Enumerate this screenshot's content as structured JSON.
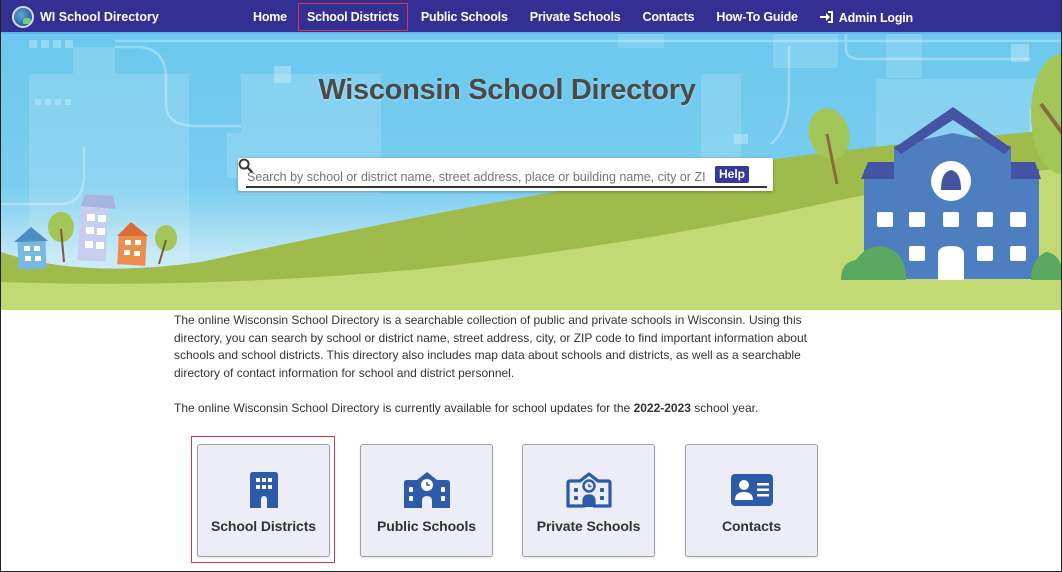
{
  "nav": {
    "brand": "WI School Directory",
    "brand_icon": "globe-logo-icon",
    "items": [
      {
        "label": "Home",
        "active": false
      },
      {
        "label": "School Districts",
        "active": true
      },
      {
        "label": "Public Schools",
        "active": false
      },
      {
        "label": "Private Schools",
        "active": false
      },
      {
        "label": "Contacts",
        "active": false
      },
      {
        "label": "How-To Guide",
        "active": false
      },
      {
        "label": "Admin Login",
        "active": false,
        "icon": "sign-in-icon"
      }
    ]
  },
  "hero": {
    "title": "Wisconsin School Directory",
    "search": {
      "placeholder": "Search by school or district name, street address, place or building name, city or ZIP",
      "value": "",
      "help_label": "Help",
      "search_icon": "magnifier-icon"
    }
  },
  "intro": {
    "paragraph": "The online Wisconsin School Directory is a searchable collection of public and private schools in Wisconsin. Using this directory, you can search by school or district name, street address, city, or ZIP code to find important information about schools and school districts. This directory also includes map data about schools and districts, as well as a searchable directory of contact information for school and district personnel.",
    "availability_prefix": "The online Wisconsin School Directory is currently available for school updates for the ",
    "availability_year": "2022-2023",
    "availability_suffix": " school year."
  },
  "tiles": [
    {
      "label": "School Districts",
      "icon": "building-icon",
      "focused": true
    },
    {
      "label": "Public Schools",
      "icon": "school-icon",
      "focused": false
    },
    {
      "label": "Private Schools",
      "icon": "school-outline-icon",
      "focused": false
    },
    {
      "label": "Contacts",
      "icon": "id-card-icon",
      "focused": false
    }
  ],
  "colors": {
    "nav_bg": "#332f93",
    "focus_outline": "#e0334a",
    "icon_blue": "#2e5ba8",
    "tile_bg": "#ecedf6",
    "help_button": "#353999"
  }
}
